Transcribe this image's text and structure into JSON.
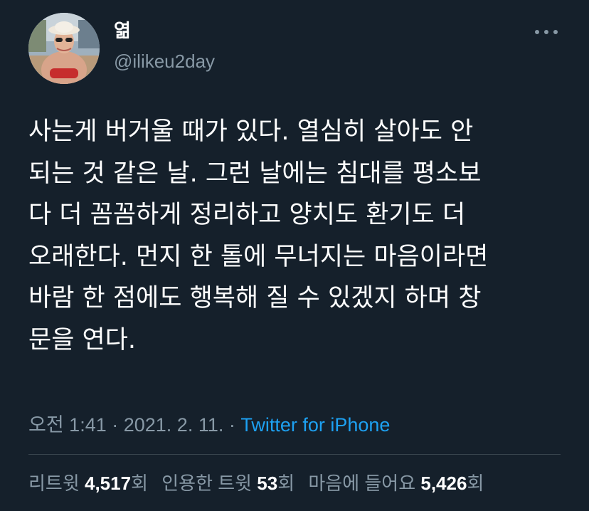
{
  "user": {
    "display_name": "엶",
    "handle": "@ilikeu2day"
  },
  "tweet": {
    "lines": [
      "사는게 버거울 때가 있다. 열심히 살아도 안",
      "되는 것 같은 날. 그런 날에는 침대를 평소보",
      "다 더 꼼꼼하게 정리하고 양치도 환기도 더",
      "오래한다. 먼지 한 톨에 무너지는 마음이라면",
      "바람 한 점에도 행복해 질 수 있겠지 하며 창",
      "문을 연다."
    ]
  },
  "meta": {
    "time": "오전 1:41",
    "separator": " · ",
    "date": "2021. 2. 11.",
    "source": "Twitter for iPhone"
  },
  "stats": {
    "retweets_label": "리트윗",
    "retweets_count": "4,517",
    "retweets_unit": "회",
    "quotes_label": "인용한 트윗",
    "quotes_count": "53",
    "quotes_unit": "회",
    "likes_label": "마음에 들어요",
    "likes_count": "5,426",
    "likes_unit": "회"
  },
  "icons": {
    "more": "more-horizontal-icon"
  },
  "colors": {
    "background": "#15202b",
    "text": "#ffffff",
    "secondary": "#8899a6",
    "link": "#1da1f2",
    "divider": "#38444d"
  }
}
